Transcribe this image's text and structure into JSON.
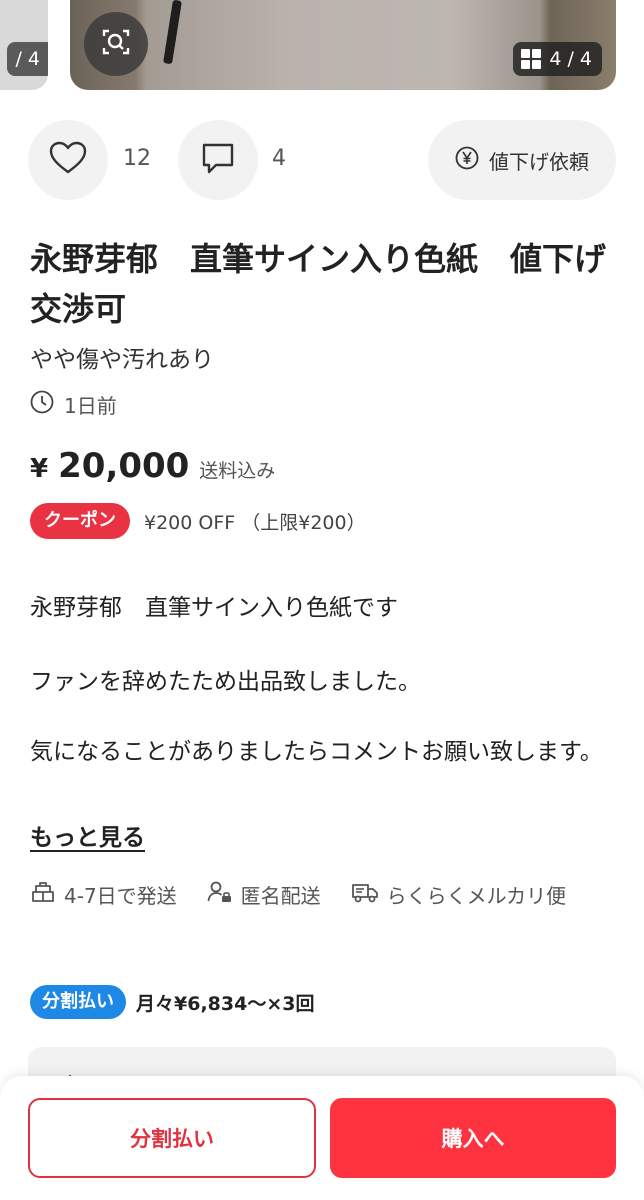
{
  "carousel": {
    "prev_counter": "/ 4",
    "main_counter": "4 / 4"
  },
  "actions": {
    "like_count": "12",
    "comment_count": "4",
    "price_request_label": "値下げ依頼"
  },
  "item": {
    "title": "永野芽郁　直筆サイン入り色紙　値下げ交渉可",
    "condition": "やや傷や汚れあり",
    "posted": "1日前",
    "price_symbol": "¥",
    "price": "20,000",
    "shipping_included": "送料込み",
    "coupon_badge": "クーポン",
    "coupon_text": "¥200 OFF （上限¥200）"
  },
  "description": {
    "lines": [
      "永野芽郁　直筆サイン入り色紙です",
      "ファンを辞めたため出品致しました。",
      "気になることがありましたらコメントお願い致します。"
    ],
    "more_link": "もっと見る"
  },
  "shipping": {
    "days": "4-7日で発送",
    "anonymous": "匿名配送",
    "method": "らくらくメルカリ便"
  },
  "installment": {
    "badge": "分割払い",
    "text": "月々¥6,834〜×3回"
  },
  "bottom": {
    "installment_button": "分割払い",
    "buy_button": "購入へ"
  },
  "colors": {
    "accent_red": "#ff333f",
    "coupon_red": "#ea3342",
    "installment_blue": "#1e88e5"
  }
}
